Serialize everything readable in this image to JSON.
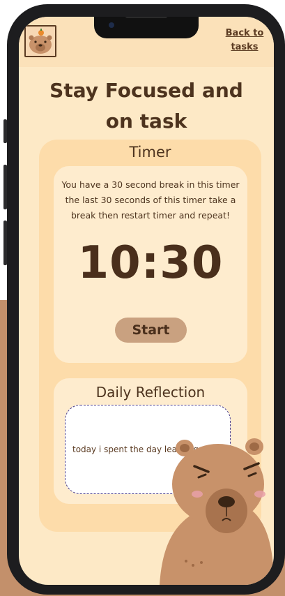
{
  "header": {
    "back_link": "Back to tasks"
  },
  "page": {
    "title": "Stay Focused and on task"
  },
  "timer": {
    "heading": "Timer",
    "description": "You have a 30 second break in this timer the last 30 seconds of this timer take a break then restart timer and repeat!",
    "display": "10:30",
    "start_label": "Start"
  },
  "reflection": {
    "heading": "Daily Reflection",
    "value": "today i spent the  day learning"
  },
  "icons": {
    "logo": "capybara-avatar-icon",
    "mascot": "capybara-mascot-icon"
  },
  "colors": {
    "background": "#fde9c6",
    "header": "#fbe1b9",
    "card": "#fddcaa",
    "inner_card": "#feecce",
    "text": "#4d331e",
    "button": "#c9a180",
    "capybara": "#c8926a"
  }
}
